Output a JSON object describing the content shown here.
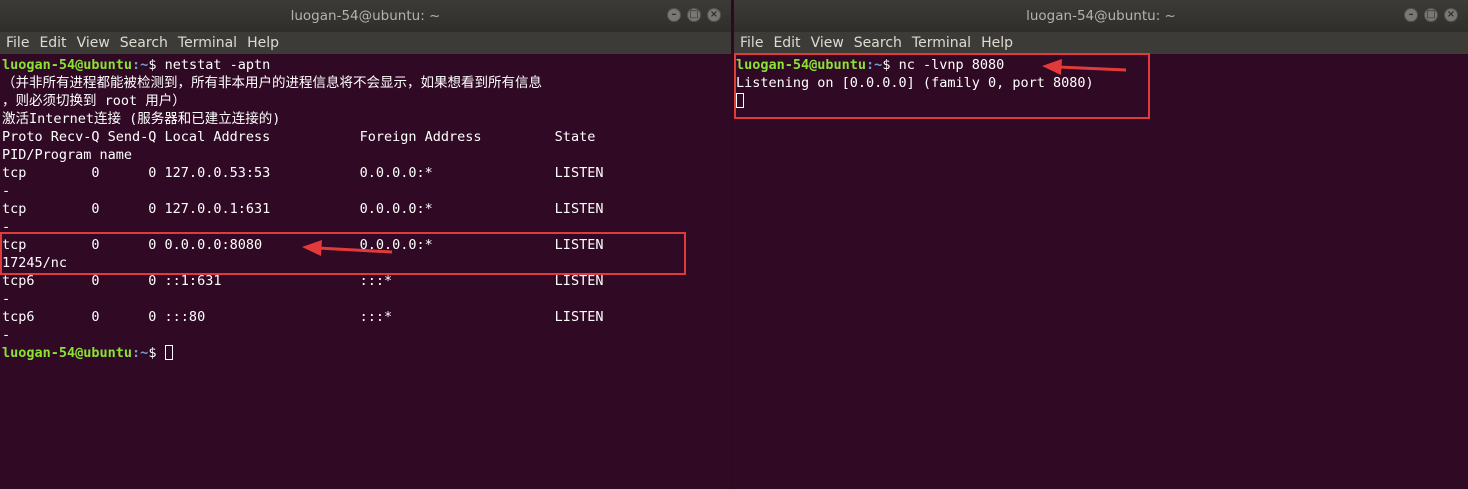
{
  "left": {
    "title": "luogan-54@ubuntu: ~",
    "menu": [
      "File",
      "Edit",
      "View",
      "Search",
      "Terminal",
      "Help"
    ],
    "prompt_user": "luogan-54@ubuntu",
    "prompt_path": ":~",
    "prompt_dollar": "$ ",
    "command": "netstat -aptn",
    "notice1": "（并非所有进程都能被检测到，所有非本用户的进程信息将不会显示，如果想看到所有信息",
    "notice2": "，则必须切换到 root 用户）",
    "notice3": "激活Internet连接 (服务器和已建立连接的)",
    "header": "Proto Recv-Q Send-Q Local Address           Foreign Address         State",
    "header2": "PID/Program name",
    "rows": [
      {
        "line": "tcp        0      0 127.0.0.53:53           0.0.0.0:*               LISTEN",
        "pid": "-"
      },
      {
        "line": "tcp        0      0 127.0.0.1:631           0.0.0.0:*               LISTEN",
        "pid": "-"
      },
      {
        "line": "tcp        0      0 0.0.0.0:8080            0.0.0.0:*               LISTEN",
        "pid": "17245/nc"
      },
      {
        "line": "tcp6       0      0 ::1:631                 :::*                    LISTEN",
        "pid": "-"
      },
      {
        "line": "tcp6       0      0 :::80                   :::*                    LISTEN",
        "pid": "-"
      }
    ]
  },
  "right": {
    "title": "luogan-54@ubuntu: ~",
    "menu": [
      "File",
      "Edit",
      "View",
      "Search",
      "Terminal",
      "Help"
    ],
    "prompt_user": "luogan-54@ubuntu",
    "prompt_path": ":~",
    "prompt_dollar": "$ ",
    "command": "nc -lvnp 8080",
    "output": "Listening on [0.0.0.0] (family 0, port 8080)"
  },
  "window_controls": {
    "minimize": "–",
    "maximize": "□",
    "close": "×"
  },
  "colors": {
    "terminal_bg": "#300a24",
    "prompt_user": "#8ae234",
    "prompt_path": "#729fcf",
    "annotation": "#e23a3a"
  }
}
